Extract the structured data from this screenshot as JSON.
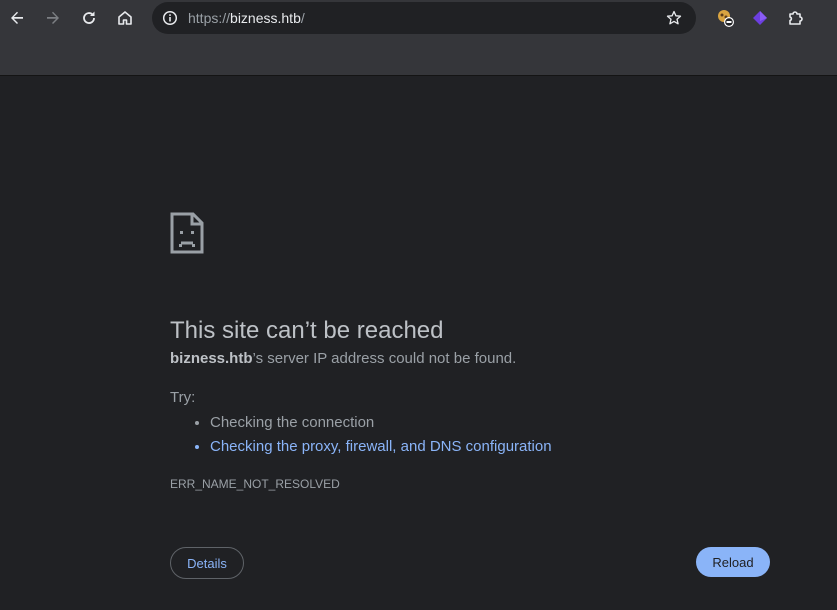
{
  "browser": {
    "url_scheme": "https://",
    "url_host": "bizness.htb",
    "url_path": "/",
    "icons": [
      "back-icon",
      "forward-icon",
      "reload-icon",
      "home-icon",
      "site-info-icon",
      "bookmark-star-icon",
      "extension-wappalyzer-icon",
      "extension-purple-icon",
      "extensions-puzzle-icon"
    ]
  },
  "error_page": {
    "title": "This site can’t be reached",
    "host": "bizness.htb",
    "description_rest": "’s server IP address could not be found.",
    "try_label": "Try:",
    "suggestions": [
      "Checking the connection",
      "Checking the proxy, firewall, and DNS configuration"
    ],
    "error_code": "ERR_NAME_NOT_RESOLVED",
    "details_label": "Details",
    "reload_label": "Reload"
  },
  "colors": {
    "background": "#202124",
    "toolbar": "#35363a",
    "link": "#8ab4f8",
    "text": "#9aa0a6",
    "heading": "#bdc1c6"
  }
}
